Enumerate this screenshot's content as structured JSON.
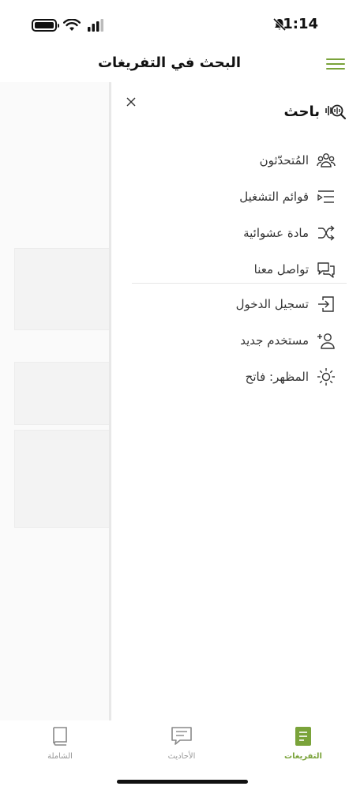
{
  "status_bar": {
    "time": "1:14",
    "icons": [
      "battery-icon",
      "wifi-icon",
      "signal-icon",
      "bell-muted-icon"
    ]
  },
  "header": {
    "title": "البحث في التفريغات",
    "menu_icon": "hamburger-icon"
  },
  "drawer": {
    "brand": "باحث",
    "brand_icon": "sound-search-icon",
    "close_icon": "close-icon",
    "items": [
      {
        "label": "المُتحدّثون",
        "icon": "people-icon"
      },
      {
        "label": "قوائم التشغيل",
        "icon": "playlist-icon"
      },
      {
        "label": "مادة عشوائية",
        "icon": "shuffle-icon"
      },
      {
        "label": "تواصل معنا",
        "icon": "chat-icon"
      }
    ],
    "account_items": [
      {
        "label": "تسجيل الدخول",
        "icon": "login-icon"
      },
      {
        "label": "مستخدم جديد",
        "icon": "add-user-icon"
      },
      {
        "label": "المظهر: فاتح",
        "icon": "sun-icon"
      }
    ]
  },
  "tabbar": {
    "tabs": [
      {
        "label": "التفريغات",
        "icon": "transcripts-icon",
        "active": true
      },
      {
        "label": "الأحاديث",
        "icon": "chat-bubble-icon",
        "active": false
      },
      {
        "label": "الشاملة",
        "icon": "book-icon",
        "active": false
      }
    ]
  },
  "colors": {
    "accent": "#7aa33a",
    "text": "#222222",
    "muted": "#999999"
  }
}
